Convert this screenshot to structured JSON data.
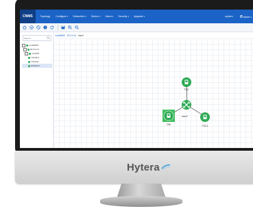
{
  "app": {
    "logo": "CNMS"
  },
  "nav": {
    "items": [
      {
        "label": "Topology",
        "caret": ""
      },
      {
        "label": "Configure",
        "caret": "▾"
      },
      {
        "label": "Subscriber",
        "caret": "▾"
      },
      {
        "label": "Device",
        "caret": "▾"
      },
      {
        "label": "Alarm",
        "caret": "▾"
      },
      {
        "label": "Security",
        "caret": "▾"
      },
      {
        "label": "Upgrade",
        "caret": "▾"
      }
    ],
    "system": "system",
    "user": "admin",
    "user_caret": "▾"
  },
  "sidebar": {
    "search_placeholder": "Search",
    "tree": [
      {
        "label": "LocalNMS",
        "toggle": "−"
      },
      {
        "label": "20.0.0.13",
        "toggle": "−"
      },
      {
        "label": "mso226...",
        "toggle": "−"
      },
      {
        "label": "TSC26.0...",
        "toggle": ""
      },
      {
        "label": "TSC126...",
        "toggle": ""
      },
      {
        "label": "DWS20.0...",
        "toggle": ""
      }
    ]
  },
  "breadcrumb": {
    "items": [
      "LocalNMS",
      "20.0.0.13",
      "mso2"
    ]
  },
  "topology": {
    "nodes": [
      {
        "id": "tsc_top",
        "label": "TSC"
      },
      {
        "id": "switch",
        "label": "mso2"
      },
      {
        "id": "dws",
        "label": "DW"
      },
      {
        "id": "tsc1",
        "label": "TSC1"
      }
    ]
  },
  "monitor": {
    "brand": "Hytera"
  },
  "colors": {
    "nav_bar": "#1b63c6",
    "node_green": "#2eaa55",
    "selected_node_bg": "#3fbf5f"
  }
}
